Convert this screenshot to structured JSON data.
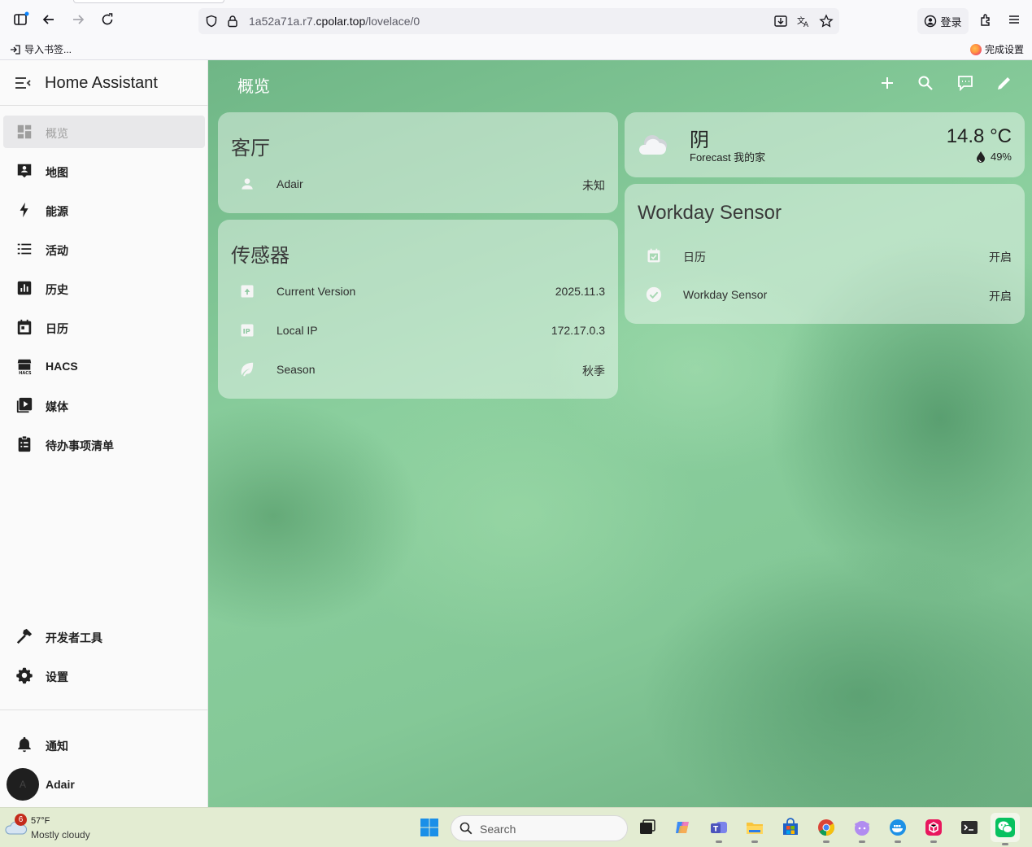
{
  "browser": {
    "url_host_prefix": "1a52a71a.r7.",
    "url_host_main": "cpolar.top",
    "url_path": "/lovelace/0",
    "login_label": "登录",
    "bookmark_import": "导入书签...",
    "bookmark_done": "完成设置"
  },
  "sidebar": {
    "title": "Home Assistant",
    "items": [
      {
        "label": "概览",
        "icon": "dashboard-icon"
      },
      {
        "label": "地图",
        "icon": "map-account-icon"
      },
      {
        "label": "能源",
        "icon": "lightning-icon"
      },
      {
        "label": "活动",
        "icon": "list-icon"
      },
      {
        "label": "历史",
        "icon": "chart-box-icon"
      },
      {
        "label": "日历",
        "icon": "calendar-icon"
      },
      {
        "label": "HACS",
        "icon": "hacs-store-icon"
      },
      {
        "label": "媒体",
        "icon": "play-box-icon"
      },
      {
        "label": "待办事项清单",
        "icon": "clipboard-list-icon"
      }
    ],
    "bottom_items": [
      {
        "label": "开发者工具",
        "icon": "hammer-icon"
      },
      {
        "label": "设置",
        "icon": "cog-icon"
      }
    ],
    "notifications_label": "通知",
    "user": {
      "initial": "A",
      "name": "Adair"
    }
  },
  "main": {
    "title": "概览",
    "living_room": {
      "title": "客厅",
      "rows": [
        {
          "name": "Adair",
          "value": "未知",
          "icon": "account-icon"
        }
      ]
    },
    "sensors": {
      "title": "传感器",
      "rows": [
        {
          "name": "Current Version",
          "value": "2025.11.3",
          "icon": "package-up-icon"
        },
        {
          "name": "Local IP",
          "value": "172.17.0.3",
          "icon": "ip-icon"
        },
        {
          "name": "Season",
          "value": "秋季",
          "icon": "leaf-icon"
        }
      ]
    },
    "weather": {
      "condition": "阴",
      "forecast": "Forecast 我的家",
      "temperature": "14.8 °C",
      "humidity": "49%",
      "icon": "cloudy-icon"
    },
    "workday": {
      "title": "Workday Sensor",
      "rows": [
        {
          "name": "日历",
          "value": "开启",
          "icon": "calendar-check-icon"
        },
        {
          "name": "Workday Sensor",
          "value": "开启",
          "icon": "check-circle-icon"
        }
      ]
    }
  },
  "taskbar": {
    "weather_badge": "6",
    "temperature": "57°F",
    "condition": "Mostly cloudy",
    "search_label": "Search"
  },
  "colors": {
    "accent_green": "#7cc293",
    "taskbar_bg": "#e3ecd2"
  }
}
